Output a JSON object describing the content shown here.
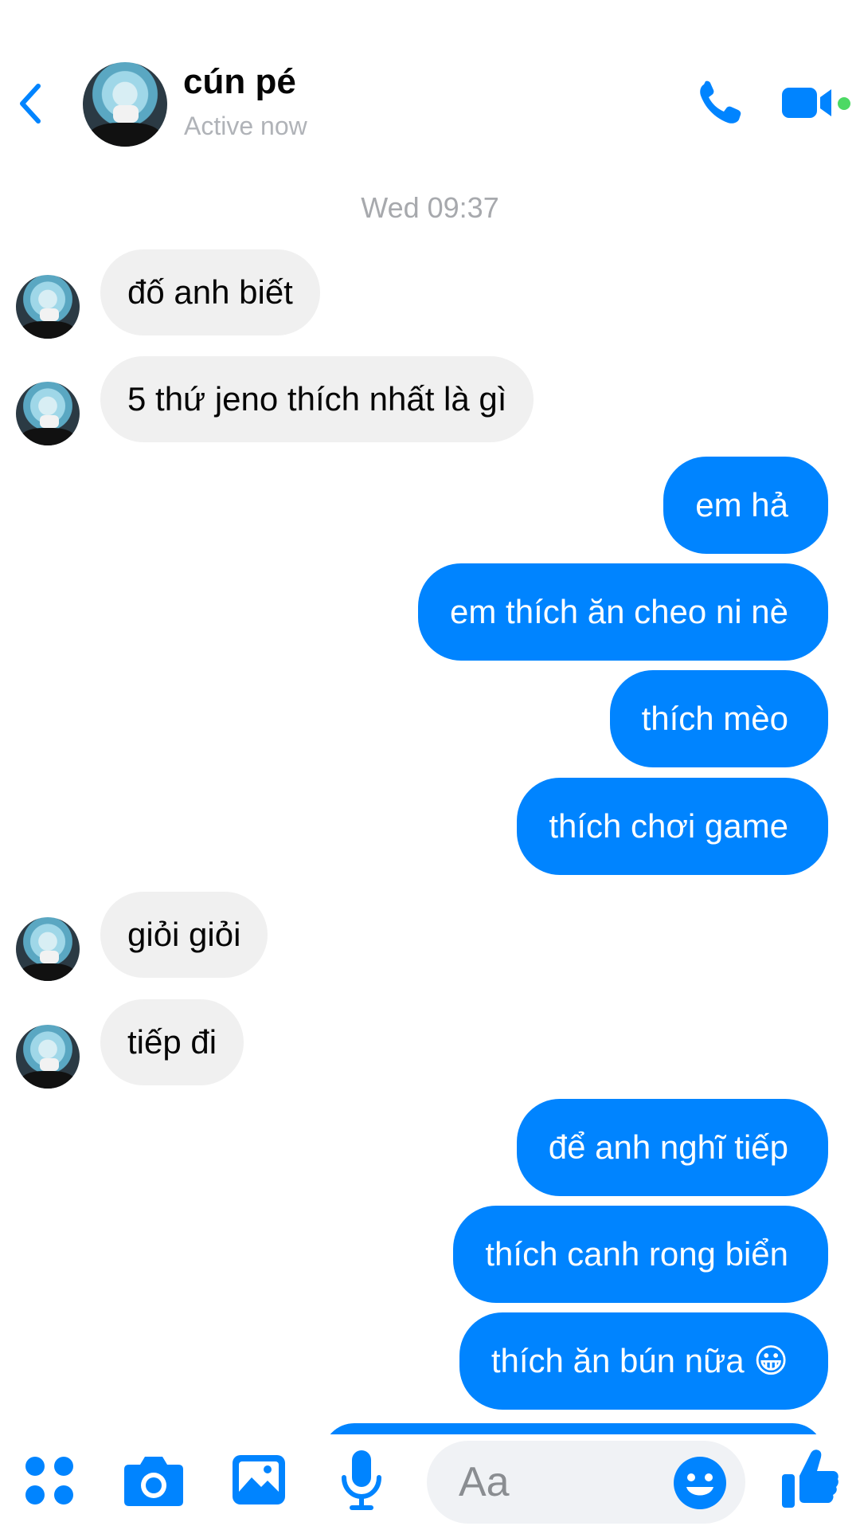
{
  "header": {
    "back_icon": "chevron-left-icon",
    "contact_name": "cún pé",
    "status": "Active now",
    "call_icon": "phone-icon",
    "video_icon": "video-camera-icon"
  },
  "conversation": {
    "timestamp": "Wed 09:37",
    "messages": [
      {
        "from": "them",
        "text": "đố anh biết"
      },
      {
        "from": "them",
        "text": "5 thứ jeno thích nhất là gì"
      },
      {
        "from": "me",
        "text": "em hả"
      },
      {
        "from": "me",
        "text": "em thích ăn cheo ni nè"
      },
      {
        "from": "me",
        "text": "thích mèo"
      },
      {
        "from": "me",
        "text": "thích chơi game"
      },
      {
        "from": "them",
        "text": "giỏi giỏi"
      },
      {
        "from": "them",
        "text": "tiếp đi"
      },
      {
        "from": "me",
        "text": "để anh nghĩ tiếp"
      },
      {
        "from": "me",
        "text": "thích canh rong biển"
      },
      {
        "from": "me",
        "text": "thích ăn bún nữa 😀"
      }
    ]
  },
  "composer": {
    "placeholder": "Aa",
    "icons": [
      "apps-grid-icon",
      "camera-icon",
      "image-icon",
      "microphone-icon",
      "emoji-icon",
      "thumbs-up-icon"
    ]
  },
  "colors": {
    "accent": "#0084ff",
    "incoming_bubble": "#f0f0f0",
    "secondary_text": "#b0b3b8",
    "online": "#4cd964"
  }
}
